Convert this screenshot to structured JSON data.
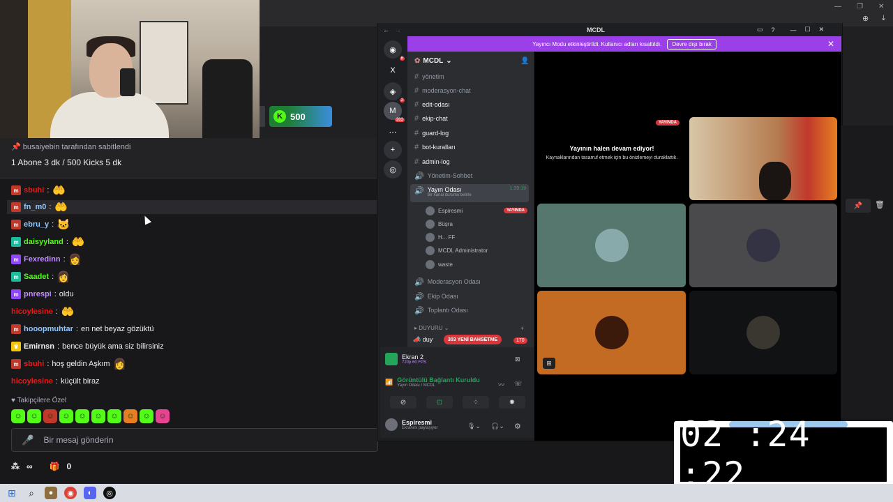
{
  "stream_chat": {
    "pinned_by": "busaiyebin tarafından sabitlendi",
    "pinned_text": "1 Abone 3 dk / 500 Kicks 5 dk",
    "kicks_amount": "500",
    "messages": [
      {
        "user": "sbuhi",
        "text": "",
        "color": "#e91916",
        "emote": "🤲"
      },
      {
        "user": "fn_m0",
        "text": "",
        "color": "#8fc7ff",
        "emote": "🤲"
      },
      {
        "user": "ebru_y",
        "text": "",
        "color": "#8fc7ff",
        "emote": "🐱"
      },
      {
        "user": "daisyyland",
        "text": "",
        "color": "#53fc18",
        "emote": "🤲"
      },
      {
        "user": "Fexredinn",
        "text": "",
        "color": "#c18cff",
        "emote": "👩"
      },
      {
        "user": "Saadet",
        "text": "",
        "color": "#53fc18",
        "emote": "👩"
      },
      {
        "user": "pnrespi",
        "text": "oldu",
        "color": "#c18cff",
        "emote": ""
      },
      {
        "user": "hicoylesine",
        "text": "",
        "color": "#e91916",
        "emote": "🤲"
      },
      {
        "user": "hooopmuhtar",
        "text": "en net beyaz gözüktü",
        "color": "#8fc7ff",
        "emote": ""
      },
      {
        "user": "Emirnsn",
        "text": "bence büyük ama siz bilirsiniz",
        "color": "#efeff1",
        "emote": ""
      },
      {
        "user": "sbuhi",
        "text": "hoş geldin Aşkım",
        "color": "#e91916",
        "emote": "👩"
      },
      {
        "user": "hicoylesine",
        "text": "küçült biraz",
        "color": "#e91916",
        "emote": ""
      }
    ],
    "follower_only_label": "Takipçilere Özel",
    "input_placeholder": "Bir mesaj gönderin",
    "bottom_count": "0",
    "infinity": "∞"
  },
  "discord": {
    "window_title": "MCDL",
    "banner_text": "Yayıncı Modu etkinleştirildi. Kullanıcı adları kısaltıldı.",
    "banner_button": "Devre dışı bırak",
    "server_name": "MCDL",
    "server_badges": [
      "6",
      "2",
      "303"
    ],
    "channels": [
      {
        "name": "yönetim",
        "type": "text",
        "bright": false
      },
      {
        "name": "moderasyon-chat",
        "type": "text",
        "bright": false
      },
      {
        "name": "edit-odası",
        "type": "text",
        "bright": true
      },
      {
        "name": "ekip-chat",
        "type": "text",
        "bright": true
      },
      {
        "name": "guard-log",
        "type": "text",
        "bright": true
      },
      {
        "name": "bot-kuralları",
        "type": "text",
        "bright": true
      },
      {
        "name": "admin-log",
        "type": "text",
        "bright": true
      },
      {
        "name": "Yönetim-Sohbet",
        "type": "voice",
        "bright": false
      }
    ],
    "active_voice": {
      "name": "Yayın Odası",
      "time": "1:39:19",
      "status": "Bir kanal durumu belirle"
    },
    "members": [
      {
        "name": "Espiresmi",
        "live": "YAYINDA"
      },
      {
        "name": "Büşra",
        "live": ""
      },
      {
        "name": "H... FF",
        "live": ""
      },
      {
        "name": "MCDL Administrator",
        "live": ""
      },
      {
        "name": "waste",
        "live": ""
      }
    ],
    "more_voice": [
      "Moderasyon Odası",
      "Ekip Odası",
      "Toplantı Odası"
    ],
    "category": "DUYURU",
    "partial_channel": "duy",
    "mention_pill": "303 YENİ BAHSETME",
    "unread_count": "170",
    "screen_share": {
      "title": "Ekran 2",
      "quality": "720p 60 FPS"
    },
    "voice_status": {
      "title": "Görüntülü Bağlantı Kuruldu",
      "channel": "Yayın Odası / MCDL"
    },
    "user": {
      "name": "Espiresmi",
      "status": "Ekranını paylaşıyor"
    },
    "stage": {
      "live_badge": "YAYINDA",
      "resume_title": "Yayının halen devam ediyor!",
      "resume_sub": "Kaynaklarından tasarruf etmek için bu önizlemeyi duraklattık."
    }
  },
  "timer": {
    "value": "02 :24 :22"
  },
  "colors": {
    "kick_green": "#53fc18",
    "discord_purple": "#9b3fe8",
    "live_red": "#da373c"
  }
}
